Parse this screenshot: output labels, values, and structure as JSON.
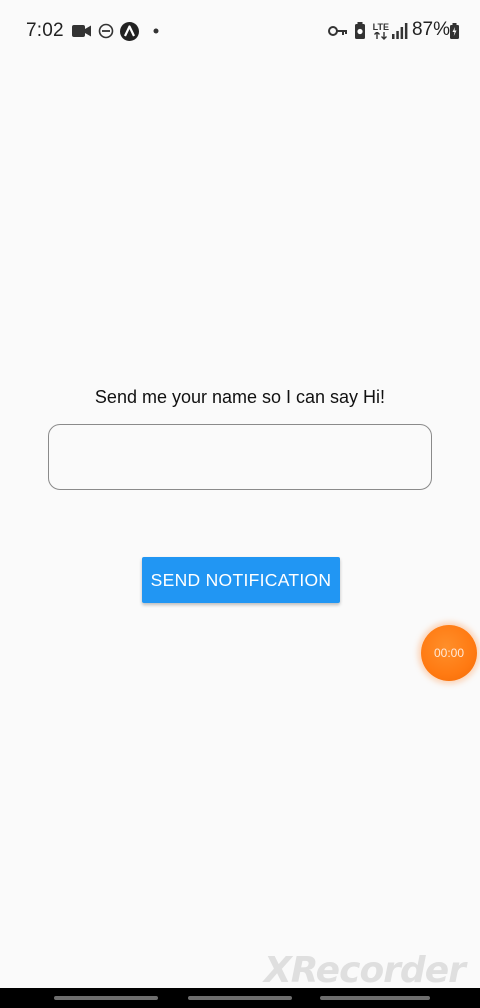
{
  "status_bar": {
    "time": "7:02",
    "battery_percent": "87%",
    "left_icons": [
      "video-camera-icon",
      "do-not-disturb-icon",
      "app-logo-icon",
      "dot-icon"
    ],
    "right_icons": [
      "vpn-key-icon",
      "battery-saver-icon",
      "lte-icon",
      "signal-icon",
      "battery-icon"
    ],
    "lte_label": "LTE"
  },
  "main": {
    "prompt": "Send me your name so I can say Hi!",
    "name_input": {
      "value": "",
      "placeholder": ""
    },
    "send_button_label": "SEND NOTIFICATION"
  },
  "recorder": {
    "time": "00:00",
    "watermark": "XRecorder"
  },
  "colors": {
    "button": "#2196f3",
    "recorder": "#ff7a12",
    "background": "#fafafa"
  }
}
